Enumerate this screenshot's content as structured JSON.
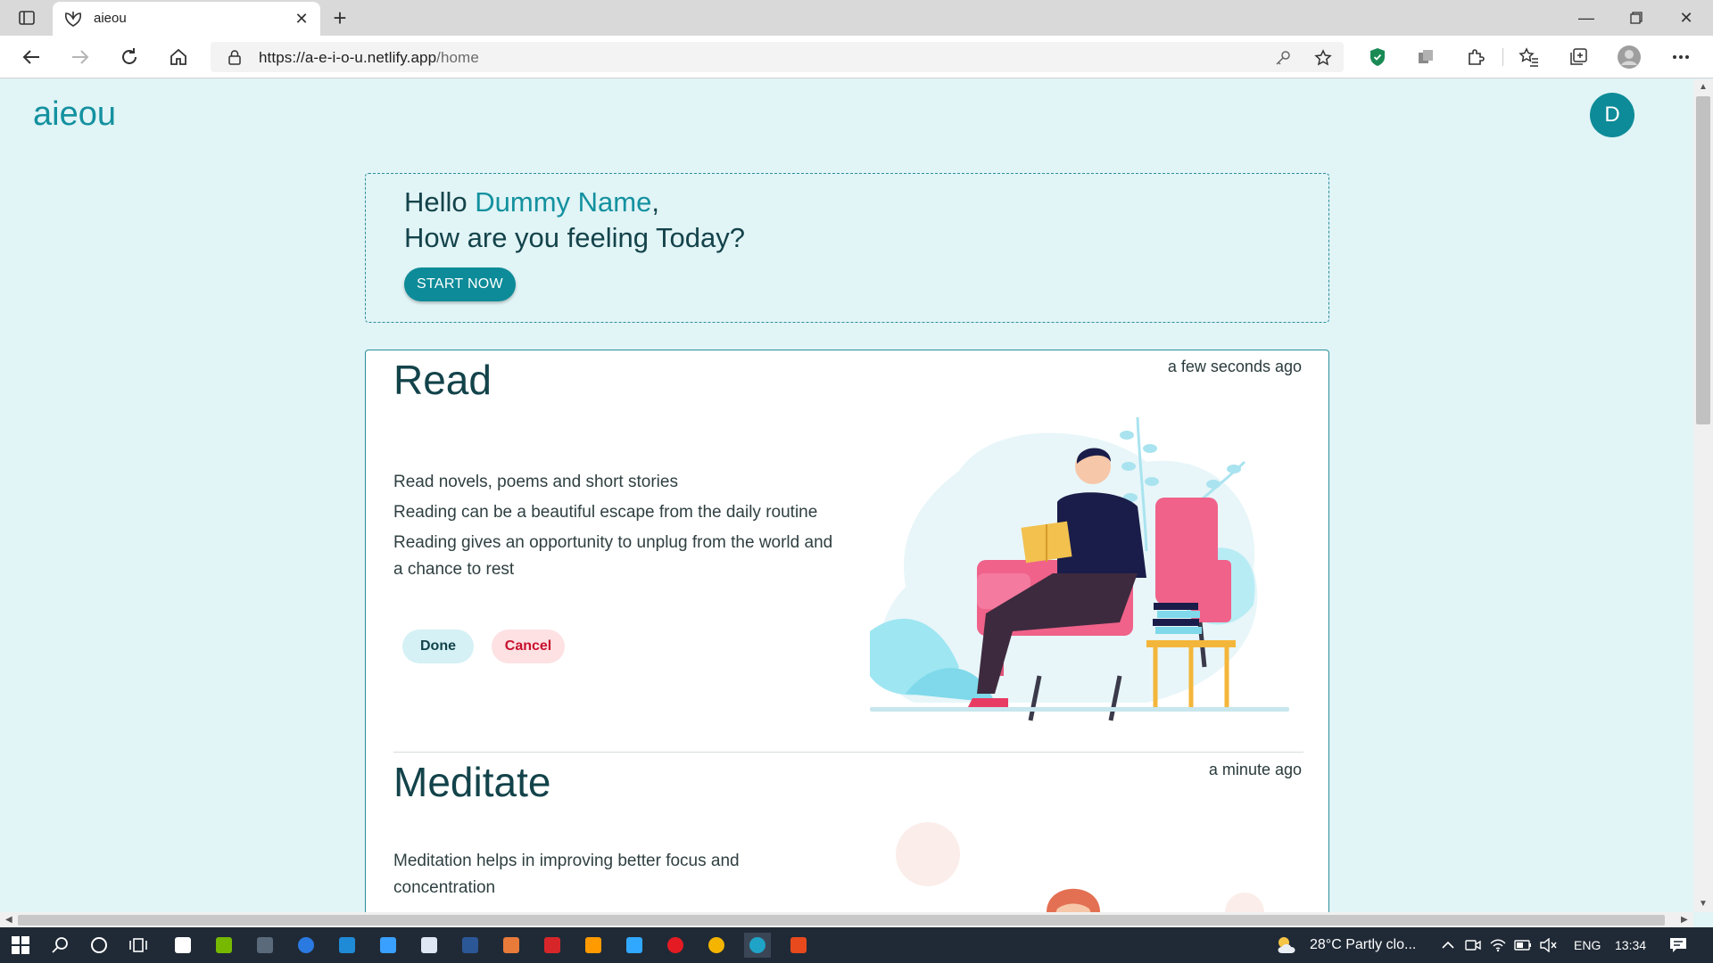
{
  "browser": {
    "tab_title": "aieou",
    "url_host": "https://a-e-i-o-u.netlify.app",
    "url_path": "/home"
  },
  "app": {
    "brand": "aiеou",
    "avatar_letter": "D"
  },
  "greeting": {
    "hello": "Hello",
    "name": "Dummy Name",
    "comma": ",",
    "question": "How are you feeling Today?",
    "start_button": "START NOW"
  },
  "activities": [
    {
      "title": "Read",
      "time": "a few seconds ago",
      "lines": [
        "Read novels, poems and short stories",
        "Reading can be a beautiful escape from the daily routine",
        "Reading gives an opportunity to unplug from the world and a chance to rest"
      ],
      "done_label": "Done",
      "cancel_label": "Cancel"
    },
    {
      "title": "Meditate",
      "time": "a minute ago",
      "lines": [
        "Meditation helps in improving better focus and concentration"
      ]
    }
  ],
  "taskbar": {
    "weather": "28°C  Partly clo...",
    "language": "ENG",
    "clock": "13:34"
  },
  "colors": {
    "brand": "#13919f",
    "page_bg": "#e1f4f6",
    "heading": "#13434a",
    "cancel": "#c8102e"
  }
}
